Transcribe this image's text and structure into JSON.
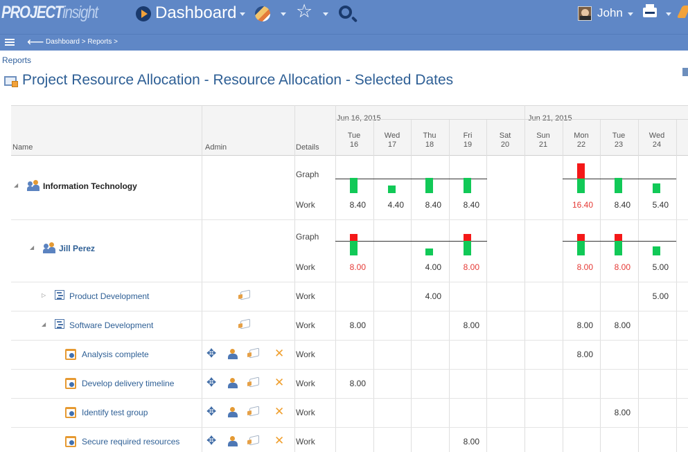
{
  "header": {
    "logo_main": "PROJECT",
    "logo_sub": "insight",
    "dashboard_label": "Dashboard",
    "user_name": "John",
    "breadcrumb": "Dashboard > Reports >"
  },
  "reports_link": "Reports",
  "page_title": "Project Resource Allocation - Resource Allocation - Selected Dates",
  "grid": {
    "col_name": "Name",
    "col_admin": "Admin",
    "col_details": "Details",
    "week1": "Jun 16, 2015",
    "week2": "Jun 21, 2015",
    "days": [
      {
        "dow": "Tue",
        "day": "16"
      },
      {
        "dow": "Wed",
        "day": "17"
      },
      {
        "dow": "Thu",
        "day": "18"
      },
      {
        "dow": "Fri",
        "day": "19"
      },
      {
        "dow": "Sat",
        "day": "20"
      },
      {
        "dow": "Sun",
        "day": "21"
      },
      {
        "dow": "Mon",
        "day": "22"
      },
      {
        "dow": "Tue",
        "day": "23"
      },
      {
        "dow": "Wed",
        "day": "24"
      }
    ],
    "graph_label": "Graph",
    "work_label": "Work",
    "rows": [
      {
        "name": "Information Technology",
        "graph": [
          {
            "green": 8.4,
            "red": 0
          },
          {
            "green": 4.4,
            "red": 0
          },
          {
            "green": 8.4,
            "red": 0
          },
          {
            "green": 8.4,
            "red": 0
          },
          null,
          null,
          {
            "green": 8.0,
            "red": 8.4
          },
          {
            "green": 8.4,
            "red": 0
          },
          {
            "green": 5.4,
            "red": 0
          }
        ],
        "work": [
          {
            "v": "8.40"
          },
          {
            "v": "4.40"
          },
          {
            "v": "8.40"
          },
          {
            "v": "8.40"
          },
          null,
          null,
          {
            "v": "16.40",
            "over": true
          },
          {
            "v": "8.40"
          },
          {
            "v": "5.40"
          }
        ]
      },
      {
        "name": "Jill Perez",
        "graph": [
          {
            "green": 8.0,
            "red": 0.0
          },
          null,
          {
            "green": 4.0,
            "red": 0
          },
          {
            "green": 8.0,
            "red": 0.0
          },
          null,
          null,
          {
            "green": 8.0,
            "red": 0.0
          },
          {
            "green": 8.0,
            "red": 0.0
          },
          {
            "green": 5.0,
            "red": 0
          }
        ],
        "work": [
          {
            "v": "8.00",
            "over": true
          },
          null,
          {
            "v": "4.00"
          },
          {
            "v": "8.00",
            "over": true
          },
          null,
          null,
          {
            "v": "8.00",
            "over": true
          },
          {
            "v": "8.00",
            "over": true
          },
          {
            "v": "5.00"
          }
        ]
      }
    ],
    "projects": [
      {
        "name": "Product Development",
        "expanded": false,
        "work": [
          null,
          null,
          "4.00",
          null,
          null,
          null,
          null,
          null,
          "5.00"
        ]
      },
      {
        "name": "Software Development",
        "expanded": true,
        "work": [
          "8.00",
          null,
          null,
          "8.00",
          null,
          null,
          "8.00",
          "8.00",
          null
        ]
      }
    ],
    "tasks": [
      {
        "name": "Analysis complete",
        "work": [
          null,
          null,
          null,
          null,
          null,
          null,
          "8.00",
          null,
          null
        ]
      },
      {
        "name": "Develop delivery timeline",
        "work": [
          "8.00",
          null,
          null,
          null,
          null,
          null,
          null,
          null,
          null
        ]
      },
      {
        "name": "Identify test group",
        "work": [
          null,
          null,
          null,
          null,
          null,
          null,
          null,
          "8.00",
          null
        ]
      },
      {
        "name": "Secure required resources",
        "work": [
          null,
          null,
          null,
          "8.00",
          null,
          null,
          null,
          null,
          null
        ]
      }
    ]
  }
}
